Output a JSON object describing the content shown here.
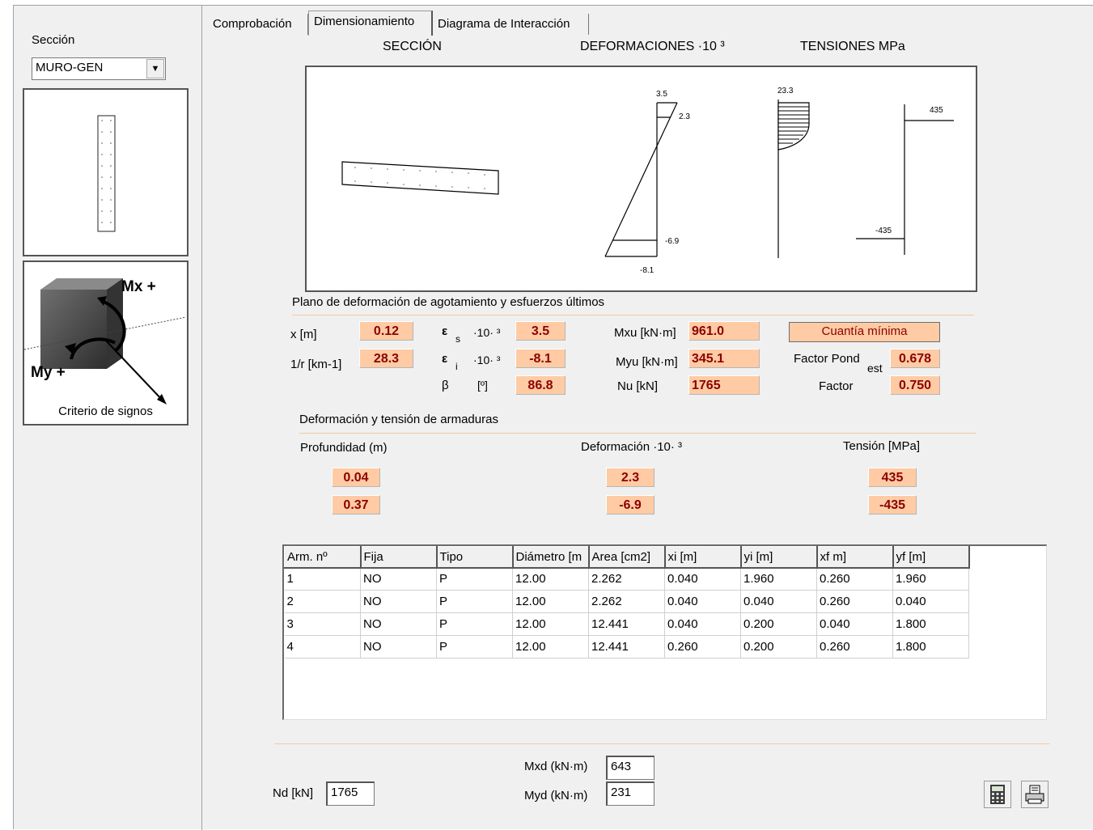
{
  "sidebar": {
    "section_label": "Sección",
    "section_value": "MURO-GEN",
    "sign_axes": {
      "mx": "Mx +",
      "my": "My +"
    },
    "sign_caption": "Criterio de signos"
  },
  "tabs": [
    {
      "label": "Comprobación",
      "active": false
    },
    {
      "label": "Dimensionamiento",
      "active": true
    },
    {
      "label": "Diagrama de Interacción",
      "active": false
    }
  ],
  "headers": {
    "section": "SECCIÓN",
    "strains": "DEFORMACIONES ·10 ³",
    "stresses": "TENSIONES MPa"
  },
  "diagram": {
    "strain_top": "3.5",
    "strain_upper_bar": "2.3",
    "strain_lower_bar": "-6.9",
    "strain_bottom": "-8.1",
    "concrete_stress": "23.3",
    "steel_pos": "435",
    "steel_neg": "-435"
  },
  "ultimate": {
    "title": "Plano de deformación de agotamiento y esfuerzos últimos",
    "x_label": "x [m]",
    "x": "0.12",
    "curv_label": "1/r [km-1]",
    "curv": "28.3",
    "eps_s_sym": "ε",
    "eps_s_sub": "s",
    "eps_s_unit": "·10· ³",
    "eps_s": "3.5",
    "eps_i_sym": "ε",
    "eps_i_sub": "i",
    "eps_i_unit": "·10· ³",
    "eps_i": "-8.1",
    "beta_label": "β",
    "beta_unit": "[º]",
    "beta": "86.8",
    "mxu_label": "Mxu [kN·m]",
    "mxu": "961.0",
    "myu_label": "Myu [kN·m]",
    "myu": "345.1",
    "nu_label": "Nu [kN]",
    "nu": "1765",
    "min_button": "Cuantía mínima",
    "factor_pond_label": "Factor Pond",
    "factor_pond_sub": "est",
    "factor_pond": "0.678",
    "factor_label": "Factor",
    "factor": "0.750"
  },
  "rebar": {
    "title": "Deformación y tensión de armaduras",
    "depth_header": "Profundidad (m)",
    "strain_header": "Deformación ·10· ³",
    "stress_header": "Tensión [MPa]",
    "rows": [
      {
        "depth": "0.04",
        "strain": "2.3",
        "stress": "435"
      },
      {
        "depth": "0.37",
        "strain": "-6.9",
        "stress": "-435"
      }
    ]
  },
  "table": {
    "columns": [
      "Arm. nº",
      "Fija",
      "Tipo",
      "Diámetro [m",
      "Area [cm2]",
      "xi [m]",
      "yi [m]",
      "xf m]",
      "yf [m]"
    ],
    "rows": [
      [
        "1",
        "NO",
        "P",
        "12.00",
        "2.262",
        "0.040",
        "1.960",
        "0.260",
        "1.960"
      ],
      [
        "2",
        "NO",
        "P",
        "12.00",
        "2.262",
        "0.040",
        "0.040",
        "0.260",
        "0.040"
      ],
      [
        "3",
        "NO",
        "P",
        "12.00",
        "12.441",
        "0.040",
        "0.200",
        "0.040",
        "1.800"
      ],
      [
        "4",
        "NO",
        "P",
        "12.00",
        "12.441",
        "0.260",
        "0.200",
        "0.260",
        "1.800"
      ]
    ]
  },
  "loads": {
    "nd_label": "Nd [kN]",
    "nd": "1765",
    "mxd_label": "Mxd (kN·m)",
    "mxd": "643",
    "myd_label": "Myd (kN·m)",
    "myd": "231"
  },
  "icons": {
    "calculate": "calculator-icon",
    "print": "printer-icon"
  },
  "colors": {
    "value_bg": "#ffcba4",
    "value_text": "#8b0000",
    "rule": "#f0c9a3"
  }
}
